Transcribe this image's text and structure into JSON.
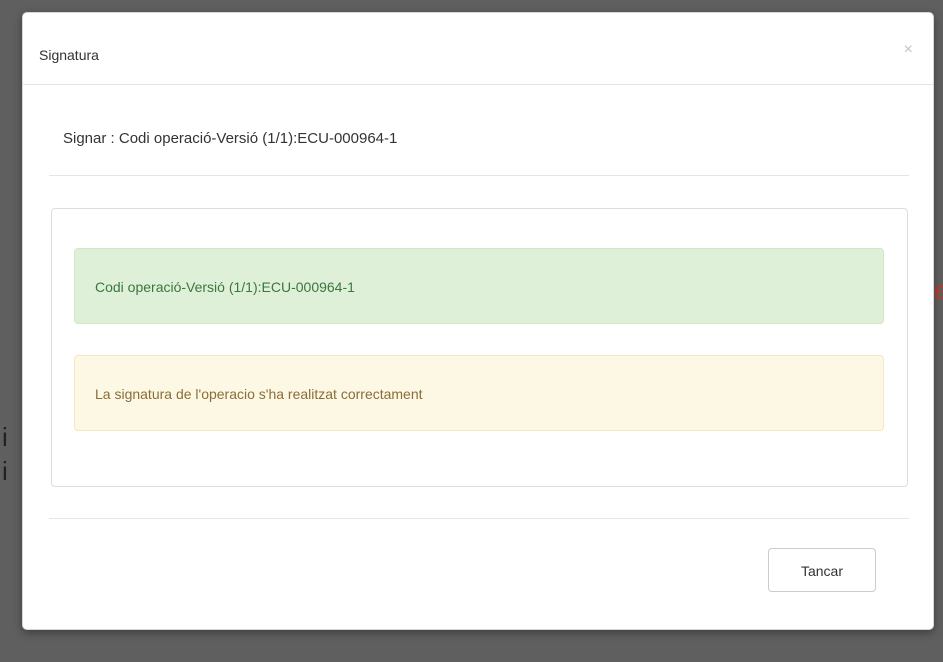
{
  "modal": {
    "title": "Signatura",
    "close_glyph": "×",
    "subtitle": "Signar : Codi operació-Versió (1/1):ECU-000964-1",
    "success_message": "Codi operació-Versió (1/1):ECU-000964-1",
    "warning_message": "La signatura de l'operacio s'ha realitzat correctament",
    "close_button_label": "Tancar"
  },
  "colors": {
    "backdrop": "#5f5f5f",
    "success_bg": "#dff0d8",
    "success_text": "#3c763d",
    "warning_bg": "#fcf8e3",
    "warning_text": "#8a6d3b"
  },
  "icons": {
    "close": "close-icon"
  }
}
